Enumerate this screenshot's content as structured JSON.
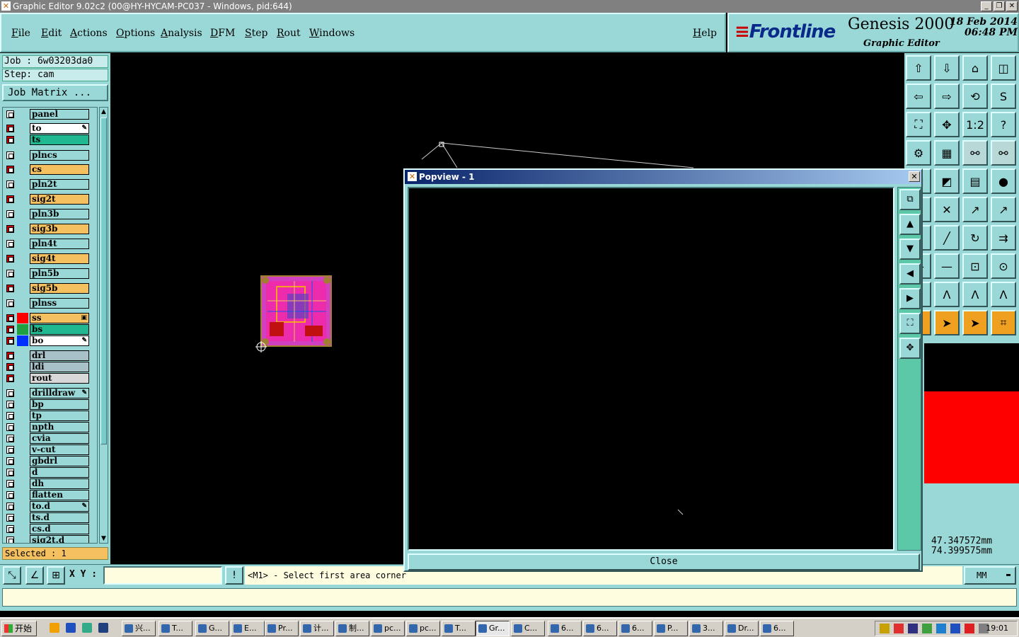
{
  "window": {
    "title": "Graphic Editor 9.02c2 (00@HY-HYCAM-PC037 - Windows, pid:644)"
  },
  "menus": [
    "File",
    "Edit",
    "Actions",
    "Options",
    "Analysis",
    "DFM",
    "Step",
    "Rout",
    "Windows",
    "Help"
  ],
  "brand": {
    "logo": "Frontline",
    "product": "Genesis 2000",
    "subtitle": "Graphic Editor",
    "date": "18 Feb 2014",
    "time": "06:48 PM"
  },
  "job": {
    "job_line": "Job : 6w03203da0",
    "step_line": "Step: cam",
    "matrix_button": "Job Matrix ..."
  },
  "layers": [
    {
      "name": "panel",
      "checked": false,
      "color": "#9ad8d8"
    },
    {
      "name": "to",
      "checked": true,
      "color": "#ffffff",
      "flag": "✎"
    },
    {
      "name": "ts",
      "checked": true,
      "color": "#20b890"
    },
    {
      "name": "plncs",
      "checked": false,
      "color": "#9ad8d8"
    },
    {
      "name": "cs",
      "checked": true,
      "color": "#f4c060"
    },
    {
      "name": "pln2t",
      "checked": false,
      "color": "#9ad8d8"
    },
    {
      "name": "sig2t",
      "checked": true,
      "color": "#f4c060"
    },
    {
      "name": "pln3b",
      "checked": false,
      "color": "#9ad8d8"
    },
    {
      "name": "sig3b",
      "checked": true,
      "color": "#f4c060"
    },
    {
      "name": "pln4t",
      "checked": false,
      "color": "#9ad8d8"
    },
    {
      "name": "sig4t",
      "checked": true,
      "color": "#f4c060"
    },
    {
      "name": "pln5b",
      "checked": false,
      "color": "#9ad8d8"
    },
    {
      "name": "sig5b",
      "checked": true,
      "color": "#f4c060"
    },
    {
      "name": "plnss",
      "checked": false,
      "color": "#9ad8d8"
    },
    {
      "name": "ss",
      "checked": true,
      "color": "#f4c060",
      "mark": "#ff0000",
      "flag": "▣"
    },
    {
      "name": "bs",
      "checked": true,
      "color": "#20b890",
      "mark": "#20a040"
    },
    {
      "name": "bo",
      "checked": true,
      "color": "#ffffff",
      "mark": "#0030ff",
      "flag": "✎"
    },
    {
      "name": "drl",
      "checked": true,
      "color": "#a8c0c8"
    },
    {
      "name": "ldi",
      "checked": true,
      "color": "#a8c0c8"
    },
    {
      "name": "rout",
      "checked": true,
      "color": "#d8d8d8"
    },
    {
      "name": "drilldraw",
      "checked": false,
      "color": "#9ad8d8",
      "flag": "✎"
    },
    {
      "name": "bp",
      "checked": false,
      "color": "#9ad8d8"
    },
    {
      "name": "tp",
      "checked": false,
      "color": "#9ad8d8"
    },
    {
      "name": "npth",
      "checked": false,
      "color": "#9ad8d8"
    },
    {
      "name": "cvia",
      "checked": false,
      "color": "#9ad8d8"
    },
    {
      "name": "v-cut",
      "checked": false,
      "color": "#9ad8d8"
    },
    {
      "name": "gbdrl",
      "checked": false,
      "color": "#9ad8d8"
    },
    {
      "name": "d",
      "checked": false,
      "color": "#9ad8d8"
    },
    {
      "name": "dh",
      "checked": false,
      "color": "#9ad8d8"
    },
    {
      "name": "flatten",
      "checked": false,
      "color": "#9ad8d8"
    },
    {
      "name": "to.d",
      "checked": false,
      "color": "#9ad8d8",
      "flag": "✎"
    },
    {
      "name": "ts.d",
      "checked": false,
      "color": "#9ad8d8"
    },
    {
      "name": "cs.d",
      "checked": false,
      "color": "#9ad8d8"
    },
    {
      "name": "sig2t.d",
      "checked": false,
      "color": "#9ad8d8"
    }
  ],
  "selected_label": "Selected : 1",
  "coords": {
    "x": "47.347572mm",
    "y": "74.399575mm"
  },
  "bottom": {
    "xy_label": "X Y :",
    "xy_value": "",
    "prompt": "<M1> - Select first area corner",
    "units": "MM"
  },
  "popup": {
    "title": "Popview - 1",
    "close_button": "Close"
  },
  "taskbar": {
    "start": "开始",
    "tasks": [
      "兴...",
      "T...",
      "G...",
      "E...",
      "Pr...",
      "计...",
      "制...",
      "pc...",
      "pc...",
      "T...",
      "Gr...",
      "C...",
      "6...",
      "6...",
      "6...",
      "P...",
      "3...",
      "Dr...",
      "6..."
    ],
    "clock": "19:01"
  }
}
